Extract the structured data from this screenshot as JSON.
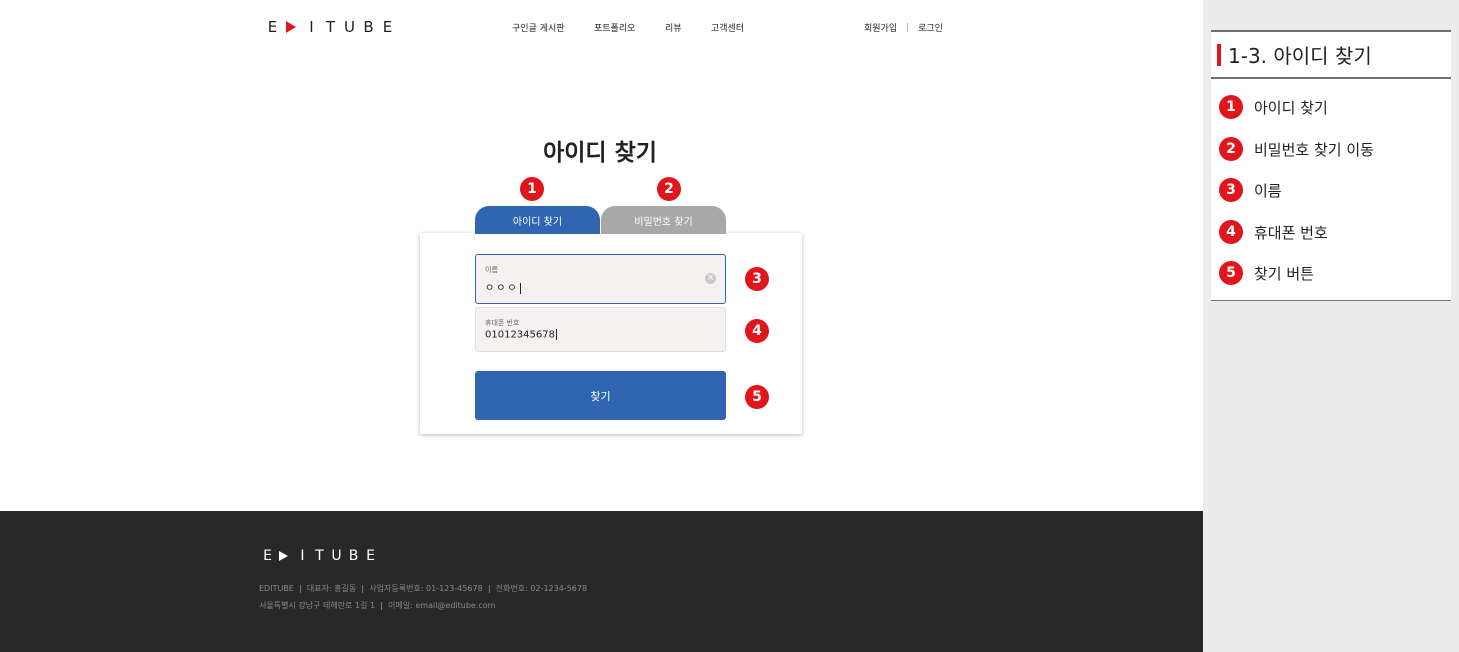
{
  "header": {
    "logo": {
      "letters_left": [
        "E"
      ],
      "letters_right": [
        "I",
        "T",
        "U",
        "B",
        "E"
      ],
      "play_icon": "play-triangle-icon"
    },
    "nav": [
      "구인글 게시판",
      "포트폴리오",
      "리뷰",
      "고객센터"
    ],
    "auth": {
      "signup": "회원가입",
      "login": "로그인"
    }
  },
  "page": {
    "title": "아이디 찾기",
    "tabs": {
      "find_id": "아이디 찾기",
      "find_password": "비밀번호 찾기"
    },
    "name_field": {
      "label": "이름",
      "value": "ㅇㅇㅇ"
    },
    "phone_field": {
      "label": "휴대폰 번호",
      "value": "01012345678"
    },
    "find_button": "찾기",
    "markers": {
      "m1": "1",
      "m2": "2",
      "m3": "3",
      "m4": "4",
      "m5": "5"
    }
  },
  "footer": {
    "logo": {
      "letters_left": [
        "E"
      ],
      "letters_right": [
        "I",
        "T",
        "U",
        "B",
        "E"
      ]
    },
    "company": "EDITUBE",
    "ceo": "대표자: 홍길동",
    "biz_no": "사업자등록번호: 01-123-45678",
    "phone": "전화번호: 02-1234-5678",
    "address": "서울특별시 강남구 테헤란로 1길 1",
    "email": "이메일: email@editube.com"
  },
  "panel": {
    "title": "1-3. 아이디 찾기",
    "items": [
      {
        "num": "1",
        "label": "아이디 찾기"
      },
      {
        "num": "2",
        "label": "비밀번호 찾기 이동"
      },
      {
        "num": "3",
        "label": "이름"
      },
      {
        "num": "4",
        "label": "휴대폰 번호"
      },
      {
        "num": "5",
        "label": "찾기 버튼"
      }
    ]
  },
  "colors": {
    "brand_blue": "#2f65b1",
    "accent_red": "#e0161c",
    "footer_bg": "#282828",
    "inactive_tab": "#a8a8a8"
  }
}
